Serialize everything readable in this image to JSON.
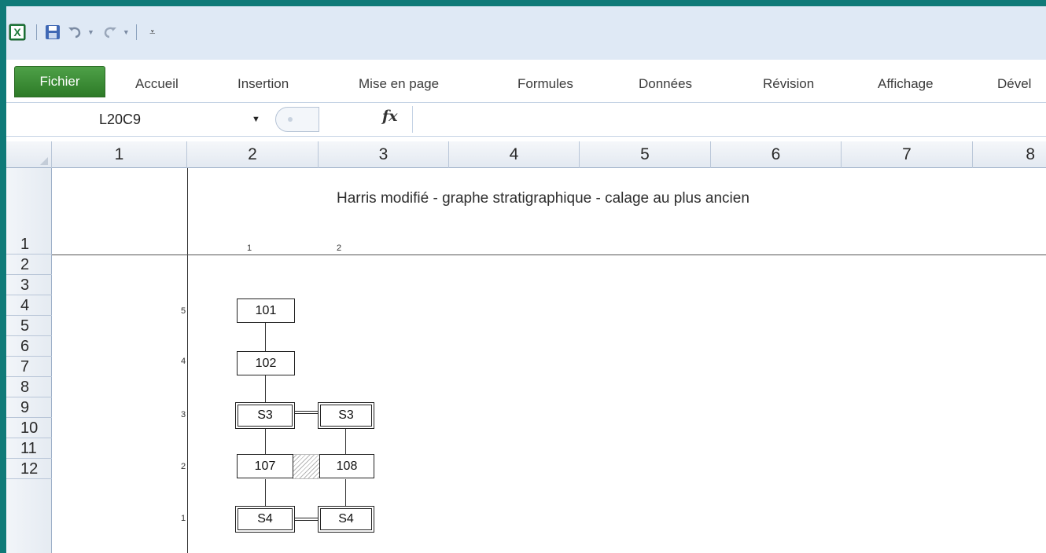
{
  "app": {
    "name": "Excel"
  },
  "ribbon": {
    "tabs": [
      "Fichier",
      "Accueil",
      "Insertion",
      "Mise en page",
      "Formules",
      "Données",
      "Révision",
      "Affichage",
      "Dével"
    ]
  },
  "formula_bar": {
    "name_box": "L20C9",
    "fx": "fx",
    "formula": ""
  },
  "grid": {
    "columns": [
      "1",
      "2",
      "3",
      "4",
      "5",
      "6",
      "7",
      "8"
    ],
    "rows": [
      "1",
      "2",
      "3",
      "4",
      "5",
      "6",
      "7",
      "8",
      "9",
      "10",
      "11",
      "12"
    ]
  },
  "sheet": {
    "title": "Harris modifié - graphe stratigraphique - calage au plus ancien",
    "col_index": [
      "1",
      "2"
    ],
    "level_labels": [
      "5",
      "4",
      "3",
      "2",
      "1"
    ]
  },
  "diagram": {
    "nodes": [
      {
        "label": "101",
        "style": "single"
      },
      {
        "label": "102",
        "style": "single"
      },
      {
        "label": "S3",
        "style": "double"
      },
      {
        "label": "S3",
        "style": "double"
      },
      {
        "label": "107",
        "style": "single"
      },
      {
        "label": "108",
        "style": "single"
      },
      {
        "label": "S4",
        "style": "double"
      },
      {
        "label": "S4",
        "style": "double"
      }
    ]
  }
}
